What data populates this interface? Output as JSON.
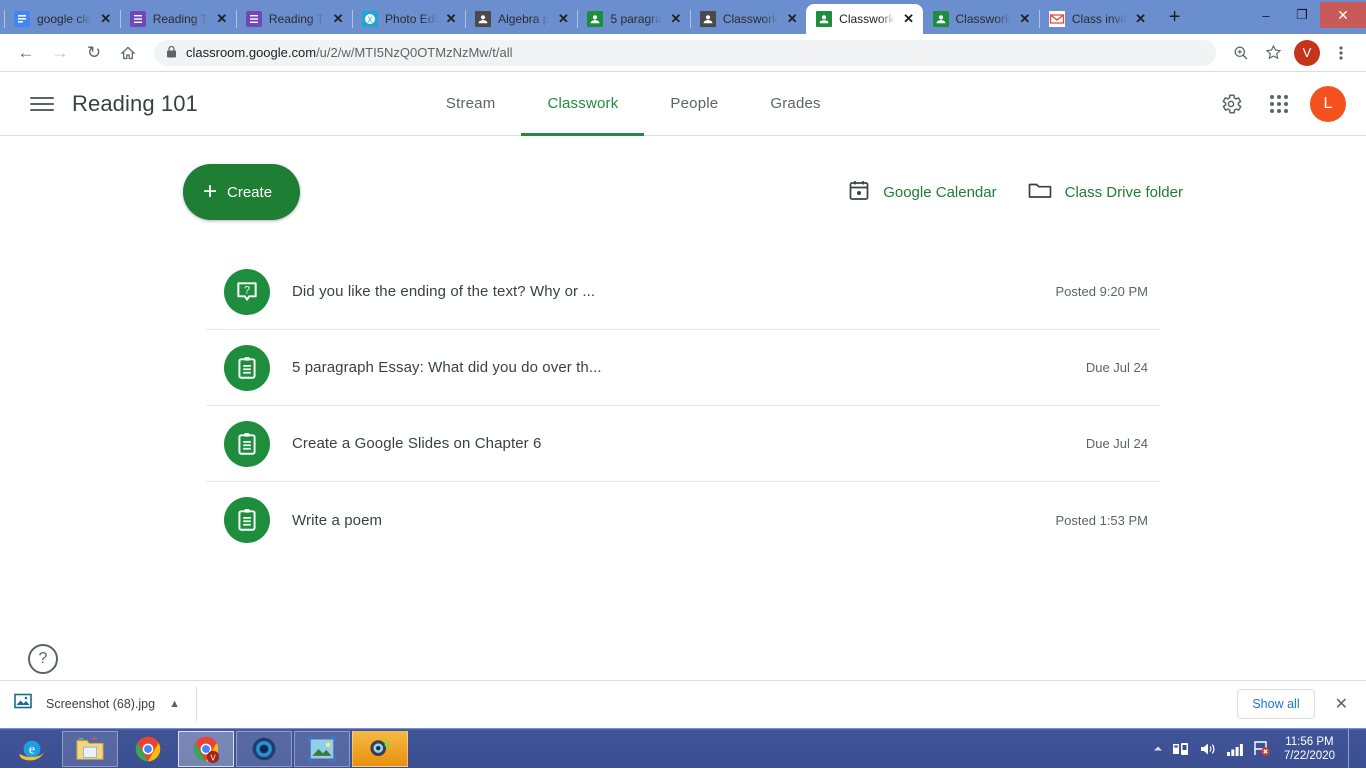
{
  "browser": {
    "tabs": [
      {
        "title": "google cla",
        "icon": "google-docs-icon",
        "active": false
      },
      {
        "title": "Reading T",
        "icon": "google-forms-icon",
        "active": false
      },
      {
        "title": "Reading T",
        "icon": "google-forms-icon",
        "active": false
      },
      {
        "title": "Photo Edi",
        "icon": "photo-editor-icon",
        "active": false
      },
      {
        "title": "Algebra p",
        "icon": "google-classroom-grey-icon",
        "active": false
      },
      {
        "title": "5 paragra",
        "icon": "google-classroom-icon",
        "active": false
      },
      {
        "title": "Classwork",
        "icon": "google-classroom-grey-icon",
        "active": false
      },
      {
        "title": "Classwork",
        "icon": "google-classroom-icon",
        "active": true
      },
      {
        "title": "Classwork",
        "icon": "google-classroom-icon",
        "active": false
      },
      {
        "title": "Class invit",
        "icon": "gmail-icon",
        "active": false
      }
    ],
    "new_tab_label": "+",
    "window_controls": {
      "minimize": "—",
      "maximize": "❐",
      "close": "×"
    },
    "nav": {
      "back": "←",
      "forward": "→",
      "reload": "↻",
      "home": "⌂"
    },
    "omnibox": {
      "lock_icon": "lock-icon",
      "url_domain": "classroom.google.com",
      "url_path": "/u/2/w/MTI5NzQ0OTMzNzMw/t/all",
      "url_full": "classroom.google.com/u/2/w/MTI5NzQ0OTMzNzMw/t/all"
    },
    "toolbar_right": {
      "zoom_icon": "zoom-in-icon",
      "bookmark_icon": "star-icon",
      "profile_initial": "V",
      "profile_color": "#c5341b",
      "menu_icon": "three-dot-menu-icon"
    }
  },
  "classroom": {
    "menu_label": "Main menu",
    "class_title": "Reading 101",
    "tabs": [
      {
        "label": "Stream",
        "active": false
      },
      {
        "label": "Classwork",
        "active": true
      },
      {
        "label": "People",
        "active": false
      },
      {
        "label": "Grades",
        "active": false
      }
    ],
    "accent_color": "#1e8e3e",
    "header_actions": {
      "settings_icon": "gear-icon",
      "apps_icon": "google-apps-grid-icon",
      "account_initial": "L",
      "account_color": "#f4511e"
    },
    "create_button": {
      "label": "Create",
      "icon": "plus-icon",
      "color": "#1e7e34"
    },
    "top_links": [
      {
        "label": "Google Calendar",
        "icon": "calendar-icon"
      },
      {
        "label": "Class Drive folder",
        "icon": "folder-icon"
      }
    ],
    "coursework": [
      {
        "title": "Did you like the ending of the text? Why or ...",
        "meta": "Posted 9:20 PM",
        "icon": "question-icon"
      },
      {
        "title": "5 paragraph Essay: What did you do over th...",
        "meta": "Due Jul 24",
        "icon": "assignment-icon"
      },
      {
        "title": "Create a Google Slides on Chapter 6",
        "meta": "Due Jul 24",
        "icon": "assignment-icon"
      },
      {
        "title": "Write a poem",
        "meta": "Posted 1:53 PM",
        "icon": "assignment-icon"
      }
    ],
    "help_icon": "help-question-icon"
  },
  "download_shelf": {
    "file_icon": "image-file-icon",
    "file_name": "Screenshot (68).jpg",
    "caret_icon": "chevron-up-icon",
    "show_all_label": "Show all",
    "close_icon": "close-icon"
  },
  "taskbar": {
    "apps": [
      {
        "name": "internet-explorer-icon",
        "state": "normal"
      },
      {
        "name": "file-explorer-icon",
        "state": "framed"
      },
      {
        "name": "chrome-icon",
        "state": "normal"
      },
      {
        "name": "chrome-profile-v-icon",
        "state": "active"
      },
      {
        "name": "media-player-icon",
        "state": "framed"
      },
      {
        "name": "photo-viewer-icon",
        "state": "framed"
      },
      {
        "name": "photo-editor-icon",
        "state": "framed"
      }
    ],
    "tray": {
      "show_hidden_icon": "chevron-up-icon",
      "usb_icon": "usb-device-icon",
      "volume_icon": "speaker-icon",
      "network_icon": "signal-bars-icon",
      "action_center_icon": "flag-error-icon"
    },
    "clock": {
      "time": "11:56 PM",
      "date": "7/22/2020"
    }
  }
}
